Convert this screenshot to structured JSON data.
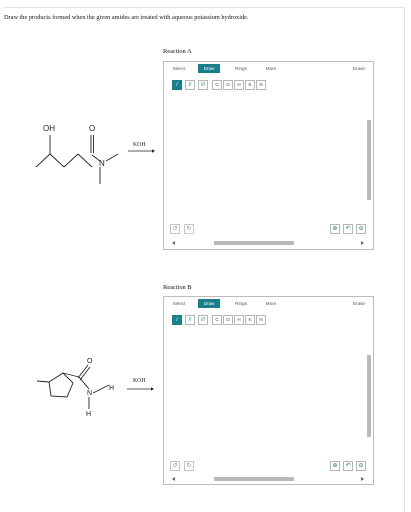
{
  "question": "Draw the products formed when the given amides are treated with aqueous potassium hydroxide.",
  "reactions": [
    {
      "title": "Reaction A",
      "reagent": "KOH",
      "atoms": {
        "oh": "OH",
        "o": "O",
        "n": "N"
      },
      "toolbar": {
        "tabs": [
          "Select",
          "Draw",
          "Rings",
          "More"
        ],
        "erase": "Erase",
        "atoms": [
          "C",
          "O",
          "H",
          "K",
          "N"
        ]
      }
    },
    {
      "title": "Reaction B",
      "reagent": "KOH",
      "atoms": {
        "o": "O",
        "n": "N",
        "h1": "H",
        "h2": "H"
      },
      "toolbar": {
        "tabs": [
          "Select",
          "Draw",
          "Rings",
          "More"
        ],
        "erase": "Erase",
        "atoms": [
          "C",
          "O",
          "H",
          "K",
          "N"
        ]
      }
    }
  ],
  "icons": {
    "single_bond": "single-bond-icon",
    "double_bond": "double-bond-icon",
    "triple_bond": "triple-bond-icon",
    "undo": "undo-icon",
    "redo": "redo-icon",
    "zoom_in": "zoom-in-icon",
    "zoom_reset": "zoom-reset-icon",
    "zoom_out": "zoom-out-icon"
  },
  "colors": {
    "accent": "#1a7f8c"
  }
}
